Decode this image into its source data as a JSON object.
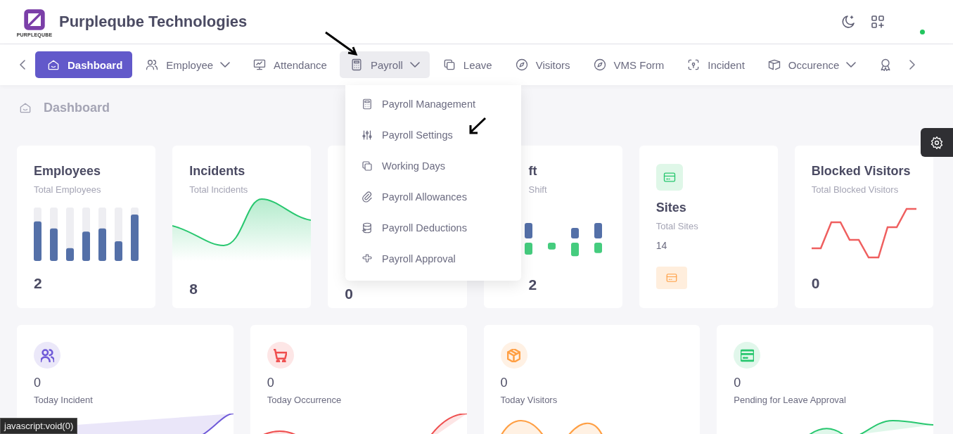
{
  "header": {
    "logo_text": "PURPLEQUBE",
    "company": "Purpleqube Technologies",
    "online": true
  },
  "nav": {
    "items": [
      {
        "label": "Dashboard",
        "selected": true
      },
      {
        "label": "Employee",
        "selected": false,
        "expanded": false
      },
      {
        "label": "Attendance",
        "selected": false
      },
      {
        "label": "Payroll",
        "selected": false,
        "expanded": true
      },
      {
        "label": "Leave",
        "selected": false
      },
      {
        "label": "Visitors",
        "selected": false
      },
      {
        "label": "VMS Form",
        "selected": false
      },
      {
        "label": "Incident",
        "selected": false
      },
      {
        "label": "Occurence",
        "selected": false,
        "expanded": false
      },
      {
        "selected": false
      }
    ]
  },
  "payroll_menu": [
    "Payroll Management",
    "Payroll Settings",
    "Working Days",
    "Payroll Allowances",
    "Payroll Deductions",
    "Payroll Approval"
  ],
  "breadcrumb": "Dashboard",
  "stat_cards": [
    {
      "kind": "bars",
      "title": "Employees",
      "subtitle": "Total Employees",
      "value": "2"
    },
    {
      "kind": "area",
      "title": "Incidents",
      "subtitle": "Total Incidents",
      "value": "8"
    },
    {
      "kind": "covered",
      "value": "0"
    },
    {
      "kind": "pairs",
      "title": "ft",
      "subtitle": "Shift",
      "value": "2"
    },
    {
      "kind": "icon",
      "title": "Sites",
      "subtitle": "Total Sites",
      "value": "14"
    },
    {
      "kind": "line",
      "title": "Blocked Visitors",
      "subtitle": "Total Blocked Visitors",
      "value": "0"
    }
  ],
  "today_cards": [
    {
      "value": "0",
      "label": "Today Incident",
      "color": "#6f5ad8"
    },
    {
      "value": "0",
      "label": "Today Occurrence",
      "color": "#ef4f4f"
    },
    {
      "value": "0",
      "label": "Today Visitors",
      "color": "#ff9f43"
    },
    {
      "value": "0",
      "label": "Pending for Leave Approval",
      "color": "#28c76f"
    }
  ],
  "status_url": "javascript:void(0)"
}
